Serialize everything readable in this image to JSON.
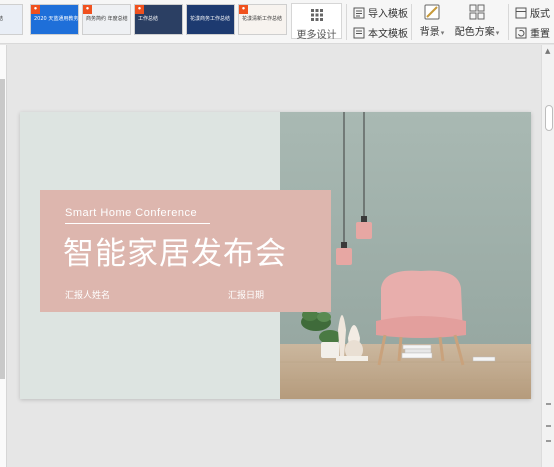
{
  "ribbon": {
    "templates": [
      {
        "name": "template-1",
        "text": "建工作总结",
        "bg": "#e9eef6",
        "light": true,
        "badge": ""
      },
      {
        "name": "template-2",
        "text": "2020 天蓝通用教务报告",
        "bg": "#1e6fd9",
        "light": false,
        "badge": "•"
      },
      {
        "name": "template-3",
        "text": "商务简约 年度总结",
        "bg": "#eef0f3",
        "light": true,
        "badge": "•"
      },
      {
        "name": "template-4",
        "text": "工作总结",
        "bg": "#2b3f63",
        "light": false,
        "badge": "•"
      },
      {
        "name": "template-5",
        "text": "花漾商务工作总结",
        "bg": "#1d3a70",
        "light": false,
        "badge": ""
      },
      {
        "name": "template-6",
        "text": "花漾清新工作总结",
        "bg": "#f7f3ef",
        "light": true,
        "badge": "•"
      }
    ],
    "more_design_label": "更多设计",
    "import_template_label": "导入模板",
    "text_template_label": "本文模板",
    "background_label": "背景",
    "color_scheme_label": "配色方案",
    "layout_label": "版式",
    "reset_label": "重置"
  },
  "slide": {
    "sub_title": "Smart Home Conference",
    "title": "智能家居发布会",
    "reporter": "汇报人姓名",
    "date": "汇报日期"
  },
  "colors": {
    "slide_bg": "#dde4e1",
    "title_box": "#ddb6ae",
    "chair": "#e8aeac",
    "lamp": "#e7a7a3",
    "floor": "#c9b399",
    "wall": "#a7b7b1"
  }
}
